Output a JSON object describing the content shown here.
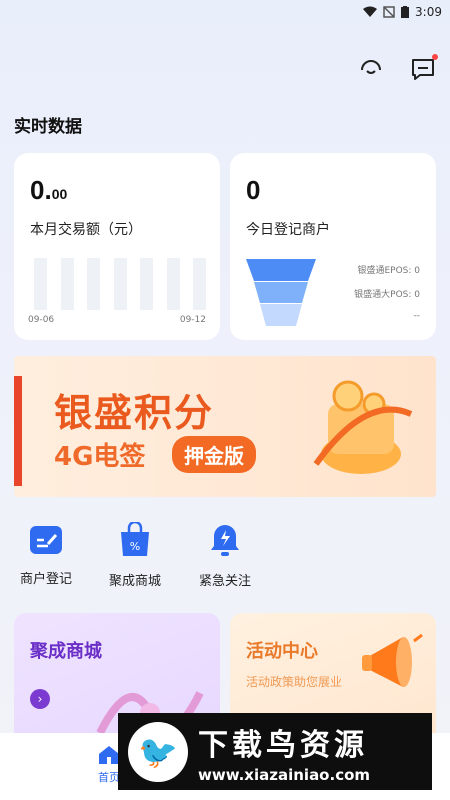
{
  "status_bar": {
    "time": "3:09"
  },
  "header": {
    "section_title": "实时数据"
  },
  "cards": {
    "monthly": {
      "value_int": "0.",
      "value_dec": "00",
      "label": "本月交易额（元）",
      "date_start": "09-06",
      "date_end": "09-12",
      "bar_count": 7
    },
    "merchants": {
      "value": "0",
      "label": "今日登记商户",
      "legend": [
        {
          "label": "银盛通EPOS: 0"
        },
        {
          "label": "银盛通大POS: 0"
        },
        {
          "label": "--"
        }
      ],
      "funnel_colors": [
        "#4d8cf5",
        "#7fb0fa",
        "#c3d9fd"
      ]
    }
  },
  "banner": {
    "title": "银盛积分",
    "subtitle": "4G电签",
    "pill": "押金版"
  },
  "shortcuts": [
    {
      "label": "商户登记",
      "icon": "register-icon",
      "color": "#2f6bf0"
    },
    {
      "label": "聚成商城",
      "icon": "shopping-bag-icon",
      "color": "#2f6bf0"
    },
    {
      "label": "紧急关注",
      "icon": "alert-bell-icon",
      "color": "#2f6bf0"
    }
  ],
  "promos": {
    "mall": {
      "title": "聚成商城",
      "title_color": "#6b2fc7"
    },
    "activity": {
      "title": "活动中心",
      "subtitle": "活动政策助您展业",
      "title_color": "#e87a2a"
    }
  },
  "tabbar": {
    "home_label": "首页"
  },
  "watermark": {
    "title": "下载鸟资源",
    "url": "www.xiazainiao.com"
  }
}
